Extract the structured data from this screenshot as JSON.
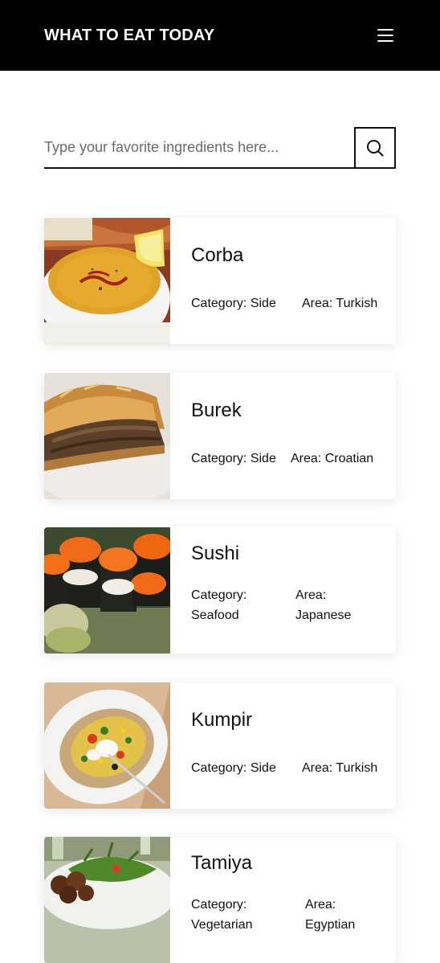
{
  "header": {
    "title": "WHAT TO EAT TODAY",
    "menu_icon": "hamburger-menu-icon"
  },
  "search": {
    "placeholder": "Type your favorite ingredients here...",
    "value": "",
    "button_icon": "search-icon"
  },
  "meals": [
    {
      "name": "Corba",
      "category": "Category: Side",
      "area": "Area: Turkish",
      "image": "lentil-soup-photo"
    },
    {
      "name": "Burek",
      "category": "Category: Side",
      "area": "Area: Croatian",
      "image": "meat-pie-photo"
    },
    {
      "name": "Sushi",
      "category": "Category: Seafood",
      "area": "Area: Japanese",
      "image": "sushi-rolls-photo"
    },
    {
      "name": "Kumpir",
      "category": "Category: Side",
      "area": "Area: Turkish",
      "image": "stuffed-potato-photo"
    },
    {
      "name": "Tamiya",
      "category": "Category: Vegetarian",
      "area": "Area: Egyptian",
      "image": "falafel-plate-photo"
    }
  ],
  "colors": {
    "header_bg": "#000000",
    "header_text": "#ffffff",
    "text": "#111111",
    "card_bg": "#ffffff"
  }
}
